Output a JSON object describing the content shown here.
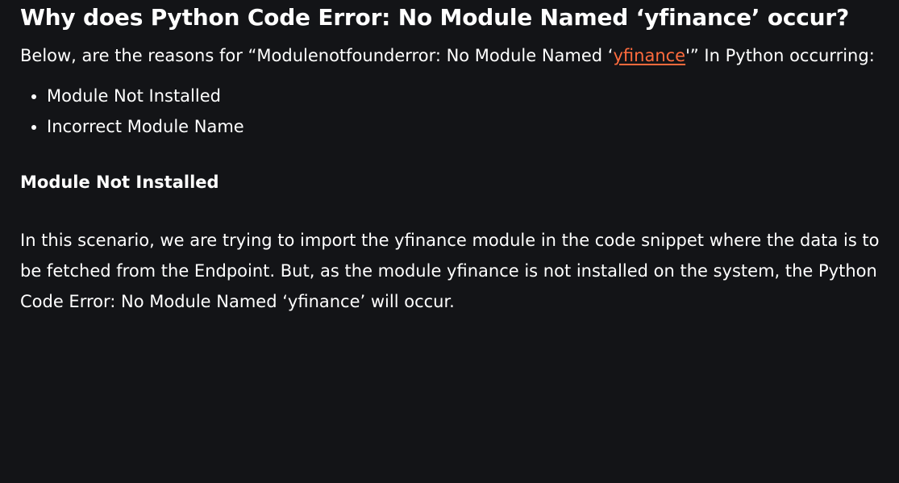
{
  "article": {
    "title": "Why does Python Code Error: No Module Named ‘yfinance’ occur?",
    "intro": {
      "before_link": "Below, are the reasons for “Modulenotfounderror: No Module Named ‘",
      "link_text": "yfinance",
      "after_link": "'” In Python occurring:"
    },
    "reasons": [
      "Module Not Installed",
      "Incorrect Module Name"
    ],
    "section": {
      "heading": "Module Not Installed",
      "body": "In this scenario, we are trying to import the yfinance module in the code snippet where the data is to be fetched from the Endpoint. But, as the module yfinance is not installed on the system, the Python Code Error: No Module Named ‘yfinance’ will occur."
    }
  },
  "colors": {
    "background": "#131417",
    "text": "#ffffff",
    "link": "#ff6b3d"
  }
}
